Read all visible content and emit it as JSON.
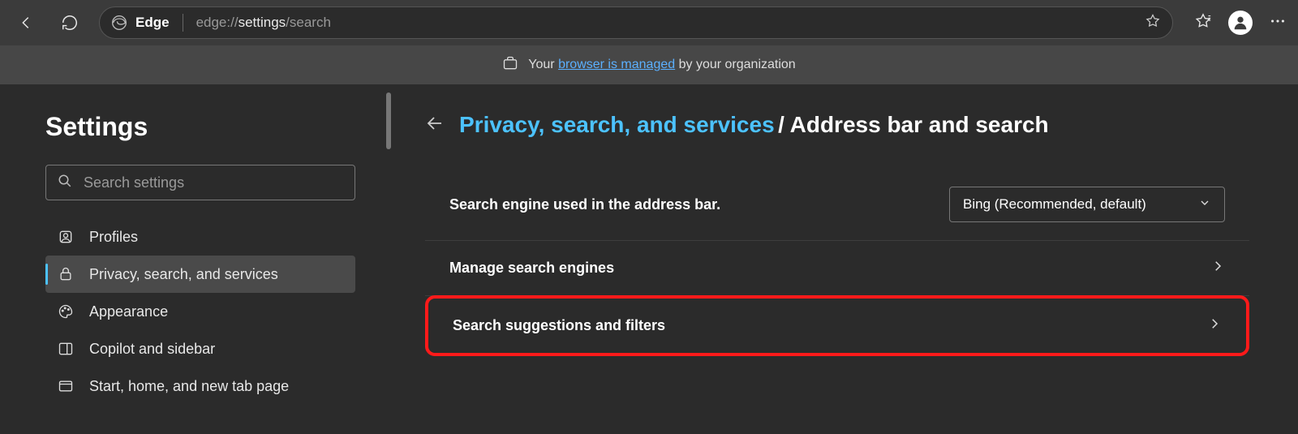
{
  "toolbar": {
    "site_label": "Edge",
    "url_dim1": "edge://",
    "url_bright": "settings",
    "url_dim2": "/search"
  },
  "managed": {
    "prefix": "Your ",
    "link": "browser is managed",
    "suffix": " by your organization"
  },
  "sidebar": {
    "title": "Settings",
    "search_placeholder": "Search settings",
    "items": [
      {
        "label": "Profiles"
      },
      {
        "label": "Privacy, search, and services"
      },
      {
        "label": "Appearance"
      },
      {
        "label": "Copilot and sidebar"
      },
      {
        "label": "Start, home, and new tab page"
      }
    ]
  },
  "breadcrumb": {
    "parent": "Privacy, search, and services",
    "current": "Address bar and search"
  },
  "rows": {
    "engine_label": "Search engine used in the address bar.",
    "engine_value": "Bing (Recommended, default)",
    "manage": "Manage search engines",
    "suggestions": "Search suggestions and filters"
  }
}
